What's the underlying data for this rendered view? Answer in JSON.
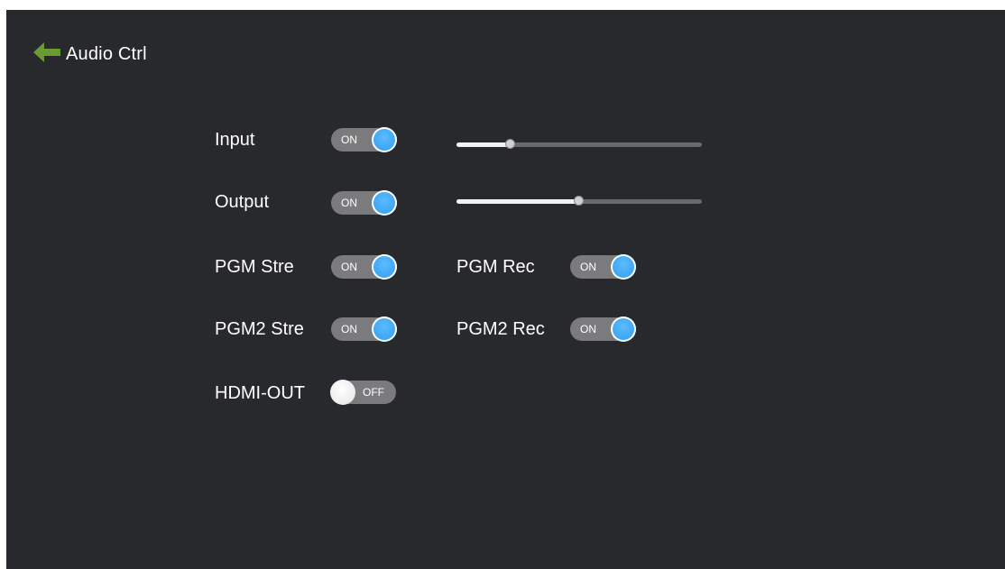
{
  "header": {
    "title": "Audio Ctrl",
    "back_icon": "arrow-left-icon",
    "back_icon_color": "#6a9a34"
  },
  "colors": {
    "background": "#28292c",
    "toggle_track": "#7b7b7d",
    "toggle_on_knob": "#3aa3f2",
    "slider_rail": "#6a6a6c",
    "slider_fill": "#f2f2f2"
  },
  "controls": {
    "input": {
      "label": "Input",
      "toggle_text": "ON",
      "state": "on",
      "level_fraction": 0.22
    },
    "output": {
      "label": "Output",
      "toggle_text": "ON",
      "state": "on",
      "level_fraction": 0.5
    },
    "pgm_stre": {
      "label": "PGM Stre",
      "toggle_text": "ON",
      "state": "on"
    },
    "pgm_rec": {
      "label": "PGM Rec",
      "toggle_text": "ON",
      "state": "on"
    },
    "pgm2_stre": {
      "label": "PGM2 Stre",
      "toggle_text": "ON",
      "state": "on"
    },
    "pgm2_rec": {
      "label": "PGM2 Rec",
      "toggle_text": "ON",
      "state": "on"
    },
    "hdmi_out": {
      "label": "HDMI-OUT",
      "toggle_text": "OFF",
      "state": "off"
    }
  }
}
